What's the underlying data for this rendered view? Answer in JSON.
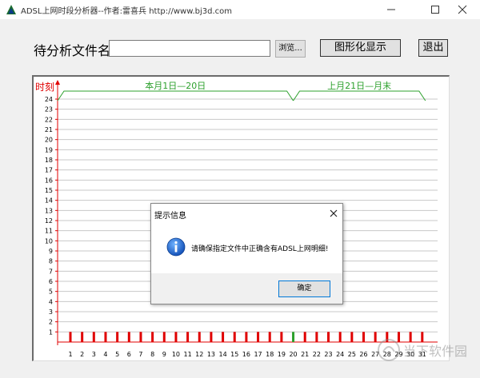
{
  "window": {
    "title": "ADSL上网时段分析器--作者:雷喜兵 http://www.bj3d.com"
  },
  "toolbar": {
    "file_label": "待分析文件名:",
    "file_value": "",
    "browse_label": "浏览...",
    "graph_label": "图形化显示",
    "exit_label": "退出"
  },
  "chart_data": {
    "type": "bar",
    "ylabel": "时刻",
    "y_ticks": [
      "1",
      "2",
      "3",
      "4",
      "5",
      "6",
      "7",
      "8",
      "9",
      "10",
      "11",
      "12",
      "13",
      "14",
      "15",
      "16",
      "17",
      "18",
      "19",
      "20",
      "21",
      "22",
      "23",
      "24"
    ],
    "ylim": [
      0,
      24
    ],
    "categories": [
      "1",
      "2",
      "3",
      "4",
      "5",
      "6",
      "7",
      "8",
      "9",
      "10",
      "11",
      "12",
      "13",
      "14",
      "15",
      "16",
      "17",
      "18",
      "19",
      "20",
      "21",
      "22",
      "23",
      "24",
      "25",
      "26",
      "27",
      "28",
      "29",
      "30",
      "31"
    ],
    "values": [
      1,
      1,
      1,
      1,
      1,
      1,
      1,
      1,
      1,
      1,
      1,
      1,
      1,
      1,
      1,
      1,
      1,
      1,
      1,
      1,
      1,
      1,
      1,
      1,
      1,
      1,
      1,
      1,
      1,
      1,
      1
    ],
    "highlight_category": "20",
    "bar_color": "#e00000",
    "highlight_color": "#2ca02c",
    "brackets": [
      {
        "label": "本月1日—20日",
        "from": 1,
        "to": 20
      },
      {
        "label": "上月21日—月末",
        "from": 20,
        "to": 31
      }
    ],
    "grid": true,
    "grid_color": "#c8c8c8",
    "axis_color": "#e00000",
    "bracket_color": "#2ca02c"
  },
  "dialog": {
    "title": "提示信息",
    "message": "请确保指定文件中正确含有ADSL上网明细!",
    "ok_label": "确定",
    "icon": "info-icon"
  },
  "watermark": {
    "text": "当下软件园"
  }
}
